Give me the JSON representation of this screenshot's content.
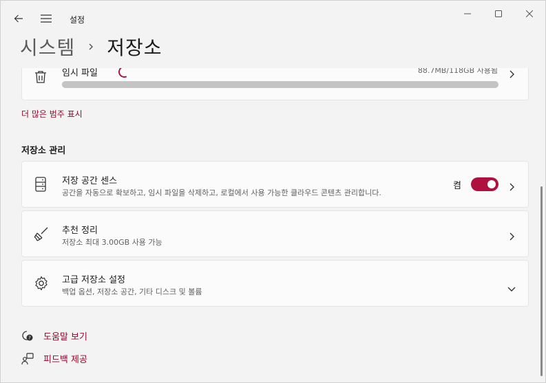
{
  "app": {
    "title": "설정"
  },
  "breadcrumb": {
    "parent": "시스템",
    "current": "저장소"
  },
  "temp_files": {
    "label": "임시 파일",
    "size": "88.7MB/118GB 사용됨",
    "progress_fraction": 0.0008
  },
  "more_categories": "더 많은 범주 표시",
  "management": {
    "title": "저장소 관리",
    "items": [
      {
        "title": "저장 공간 센스",
        "description": "공간을 자동으로 확보하고, 임시 파일을 삭제하고, 로컬에서 사용 가능한 클라우드 콘텐츠 관리합니다.",
        "toggle_label": "켬",
        "toggle_on": true
      },
      {
        "title": "추천 정리",
        "description": "저장소 최대 3.00GB 사용 가능"
      },
      {
        "title": "고급 저장소 설정",
        "description": "백업 옵션, 저장소 공간, 기타 디스크 및 볼륨"
      }
    ]
  },
  "footer": {
    "help": "도움말 보기",
    "feedback": "피드백 제공"
  },
  "colors": {
    "accent": "#b0103f",
    "link": "#8f0a2e",
    "background": "#f3f3f3",
    "card": "#fbfbfb"
  },
  "icons": [
    "back-arrow-icon",
    "hamburger-menu-icon",
    "minimize-icon",
    "maximize-icon",
    "close-icon",
    "trash-icon",
    "storage-drive-icon",
    "broom-icon",
    "gear-icon",
    "help-icon",
    "feedback-icon",
    "chevron-right-icon",
    "chevron-down-icon"
  ]
}
